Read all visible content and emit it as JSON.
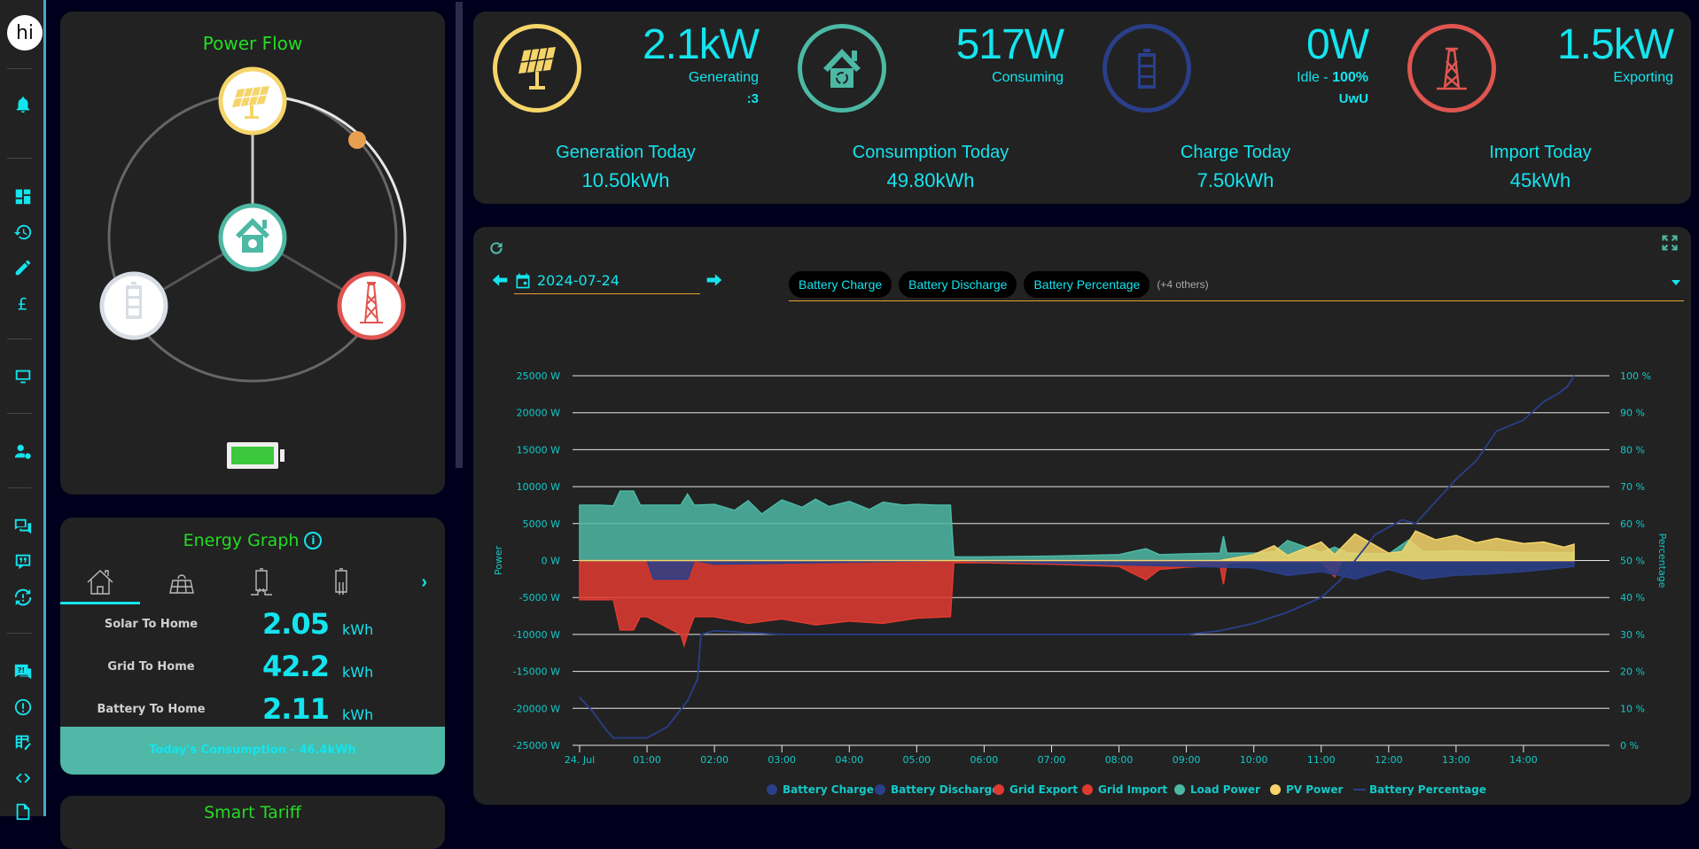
{
  "sidebar": {
    "avatar_text": "hi",
    "items": [
      {
        "icon": "bell-icon",
        "label": "Notifications"
      },
      {
        "icon": "dashboard-icon",
        "label": "Dashboard"
      },
      {
        "icon": "history-icon",
        "label": "History"
      },
      {
        "icon": "pencil-icon",
        "label": "Edit"
      },
      {
        "icon": "pound-icon",
        "label": "Tariff"
      },
      {
        "icon": "monitor-icon",
        "label": "Display"
      },
      {
        "icon": "user-settings-icon",
        "label": "User Settings"
      },
      {
        "icon": "chat-icon",
        "label": "Messages"
      },
      {
        "icon": "quote-icon",
        "label": "Feedback"
      },
      {
        "icon": "sync-alert-icon",
        "label": "Sync"
      },
      {
        "icon": "question-chat-icon",
        "label": "FAQ"
      },
      {
        "icon": "alert-circle-icon",
        "label": "Alerts"
      },
      {
        "icon": "table-edit-icon",
        "label": "Table Edit"
      },
      {
        "icon": "code-icon",
        "label": "Code"
      },
      {
        "icon": "export-icon",
        "label": "Export"
      }
    ]
  },
  "power_flow": {
    "title": "Power Flow",
    "nodes": {
      "solar": {
        "label": "Solar",
        "color": "#f5d56a"
      },
      "home": {
        "label": "Home",
        "color": "#4db8a4"
      },
      "battery": {
        "label": "Battery",
        "color": "#d8dde6"
      },
      "grid": {
        "label": "Grid",
        "color": "#e05550"
      }
    },
    "flow_dot_color": "#e8a050",
    "battery_level_percent": 100
  },
  "energy_graph": {
    "title": "Energy Graph",
    "tabs": [
      {
        "icon": "home-outline-icon",
        "label": "Home"
      },
      {
        "icon": "solar-panel-outline-icon",
        "label": "Solar"
      },
      {
        "icon": "battery-charge-outline-icon",
        "label": "Battery Charge"
      },
      {
        "icon": "battery-discharge-outline-icon",
        "label": "Battery Discharge"
      }
    ],
    "active_tab": 0,
    "rows": [
      {
        "label": "Solar To Home",
        "value": "2.05",
        "unit": "kWh"
      },
      {
        "label": "Grid To Home",
        "value": "42.2",
        "unit": "kWh"
      },
      {
        "label": "Battery To Home",
        "value": "2.11",
        "unit": "kWh"
      }
    ],
    "footer": "Today's Consumption - 46.4kWh"
  },
  "smart_tariff": {
    "title": "Smart Tariff"
  },
  "stats": [
    {
      "key": "solar",
      "value": "2.1kW",
      "status": "Generating",
      "extra": ":3",
      "today_label": "Generation Today",
      "today_value": "10.50kWh",
      "color": "#f5d56a"
    },
    {
      "key": "home",
      "value": "517W",
      "status": "Consuming",
      "extra": "",
      "today_label": "Consumption Today",
      "today_value": "49.80kWh",
      "color": "#4db8a4"
    },
    {
      "key": "battery",
      "value": "0W",
      "status_prefix": "Idle - ",
      "status_bold": "100%",
      "extra": "UwU",
      "today_label": "Charge Today",
      "today_value": "7.50kWh",
      "color": "#2a3f8a"
    },
    {
      "key": "grid",
      "value": "1.5kW",
      "status": "Exporting",
      "extra": "",
      "today_label": "Import Today",
      "today_value": "45kWh",
      "color": "#e05550"
    }
  ],
  "chart_controls": {
    "date": "2024-07-24",
    "selected_series": [
      "Battery Charge",
      "Battery Discharge",
      "Battery Percentage"
    ],
    "more_label": "(+4 others)"
  },
  "chart_data": {
    "type": "area",
    "title": "",
    "xlabel": "",
    "ylabel": "Power",
    "y2label": "Percentage",
    "ylim": [
      -25000,
      25000
    ],
    "y2lim": [
      0,
      100
    ],
    "y_ticks": [
      "25000 W",
      "20000 W",
      "15000 W",
      "10000 W",
      "5000 W",
      "0 W",
      "-5000 W",
      "-10000 W",
      "-15000 W",
      "-20000 W",
      "-25000 W"
    ],
    "y2_ticks": [
      "100 %",
      "90 %",
      "80 %",
      "70 %",
      "60 %",
      "50 %",
      "40 %",
      "30 %",
      "20 %",
      "10 %",
      "0 %"
    ],
    "x_ticks": [
      "24. Jul",
      "01:00",
      "02:00",
      "03:00",
      "04:00",
      "05:00",
      "06:00",
      "07:00",
      "08:00",
      "09:00",
      "10:00",
      "11:00",
      "12:00",
      "13:00",
      "14:00"
    ],
    "x_hours_range": [
      0,
      14.75
    ],
    "grid": true,
    "legend_position": "bottom",
    "series": [
      {
        "name": "Load Power",
        "color": "#4db8a4",
        "axis": "power",
        "x": [
          0,
          0.3,
          0.5,
          0.6,
          0.8,
          0.9,
          1.0,
          1.5,
          1.6,
          1.7,
          2.0,
          2.3,
          2.5,
          2.7,
          3.0,
          3.3,
          3.5,
          3.7,
          4.0,
          4.3,
          4.5,
          4.8,
          5.0,
          5.3,
          5.5,
          5.55,
          6.0,
          7.0,
          8.0,
          8.4,
          8.6,
          9.0,
          9.5,
          9.55,
          9.6,
          10.0,
          10.3,
          10.5,
          11.0,
          11.2,
          11.4,
          12.0,
          12.3,
          12.5,
          13.0,
          13.5,
          14.0,
          14.75
        ],
        "y": [
          7500,
          7500,
          7400,
          9400,
          9400,
          7500,
          7500,
          7500,
          9000,
          7500,
          7600,
          6800,
          8100,
          6300,
          8200,
          7200,
          8300,
          7300,
          8000,
          6900,
          7900,
          7500,
          7600,
          7500,
          7500,
          500,
          500,
          600,
          800,
          1600,
          800,
          900,
          1000,
          3300,
          1000,
          1000,
          1200,
          2700,
          1100,
          1800,
          1000,
          900,
          2800,
          1200,
          1300,
          1200,
          1100,
          1100
        ]
      },
      {
        "name": "Grid Export",
        "color": "#e03a30",
        "axis": "power",
        "x": [
          0,
          0.5,
          0.6,
          0.8,
          0.9,
          1.0,
          1.5,
          1.55,
          1.6,
          1.7,
          2.0,
          2.5,
          3.0,
          3.5,
          4.0,
          4.5,
          5.0,
          5.5,
          5.55,
          6.0,
          7.0,
          8.0,
          8.4,
          8.6,
          9.0,
          9.5,
          9.55,
          9.6,
          10.0,
          11.0,
          11.2,
          11.3,
          12.0,
          14.75
        ],
        "y": [
          -5300,
          -5300,
          -9400,
          -9400,
          -7600,
          -7600,
          -10000,
          -11500,
          -10000,
          -7600,
          -7600,
          -8500,
          -7900,
          -8700,
          -8200,
          -8500,
          -7800,
          -7600,
          -300,
          -300,
          -500,
          -800,
          -2600,
          -1200,
          -900,
          -700,
          -3200,
          -400,
          -200,
          -200,
          -2200,
          -100,
          -100,
          -100
        ]
      },
      {
        "name": "Battery Discharge",
        "color": "#2a3f8a",
        "axis": "power",
        "x": [
          0,
          1.0,
          1.1,
          1.6,
          1.7,
          2.0,
          5.5,
          10.0,
          10.5,
          11.0,
          11.5,
          12.0,
          12.5,
          13.0,
          13.5,
          14.0,
          14.75
        ],
        "y": [
          0,
          0,
          -2500,
          -2500,
          0,
          -500,
          0,
          -1000,
          -2000,
          -1500,
          -2500,
          -1200,
          -2500,
          -2000,
          -1800,
          -1500,
          -800
        ]
      },
      {
        "name": "PV Power",
        "color": "#f5d56a",
        "axis": "power",
        "x": [
          0,
          9.5,
          10.0,
          10.3,
          10.5,
          11.0,
          11.2,
          11.5,
          12.0,
          12.2,
          12.4,
          12.7,
          13.0,
          13.3,
          13.6,
          14.0,
          14.3,
          14.6,
          14.75
        ],
        "y": [
          0,
          0,
          800,
          2000,
          700,
          2500,
          800,
          3600,
          1000,
          1200,
          4000,
          2800,
          3400,
          2400,
          3000,
          2300,
          2500,
          1800,
          2200
        ]
      },
      {
        "name": "Battery Percentage",
        "color": "#2a3f8a",
        "axis": "percent",
        "x": [
          0,
          0.2,
          0.4,
          0.5,
          1.0,
          1.3,
          1.6,
          1.75,
          1.8,
          2.0,
          3.0,
          4.0,
          5.0,
          6.0,
          7.0,
          8.0,
          8.5,
          9.0,
          9.5,
          10.0,
          10.5,
          11.0,
          11.3,
          11.5,
          11.8,
          12.2,
          12.4,
          12.6,
          12.8,
          13.0,
          13.3,
          13.6,
          14.0,
          14.3,
          14.5,
          14.65,
          14.75
        ],
        "y": [
          13,
          9,
          4,
          2,
          2,
          5,
          12,
          18,
          30,
          31,
          30,
          30,
          30,
          30,
          30,
          30,
          30,
          30,
          31,
          33,
          36,
          40,
          45,
          50,
          57,
          61,
          60,
          64,
          68,
          72,
          77,
          85,
          88,
          93,
          95,
          97,
          100
        ]
      }
    ],
    "legend": [
      "Battery Charge",
      "Battery Discharge",
      "Grid Export",
      "Grid Import",
      "Load Power",
      "PV Power",
      "Battery Percentage"
    ],
    "legend_colors": [
      "#2a3f8a",
      "#2a3f8a",
      "#e03a30",
      "#e03a30",
      "#4db8a4",
      "#f5d56a",
      "#2a3f8a"
    ]
  }
}
